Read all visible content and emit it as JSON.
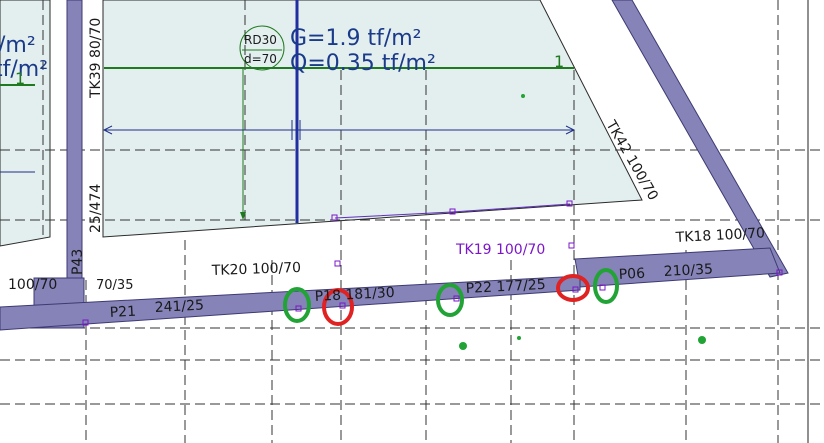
{
  "colors": {
    "beam_fill": "#8583b8",
    "beam_stroke": "#3d3a72",
    "slab_fill": "#e3eeee",
    "grid_line": "#222222",
    "dimension_line": "#1f2f8a",
    "load_line": "#1f7a1f",
    "marker_green": "#21a336",
    "marker_red": "#e02222",
    "highlight_purple": "#7b16c9"
  },
  "labels": {
    "rd30": "RD30",
    "d70": "d=70",
    "load_g": "G=1.9 tf/m²",
    "load_q": "Q=0.35 tf/m²",
    "load_number": "1",
    "left_tfm2_1": "/m²",
    "left_tfm2_2": "tf/m²",
    "left_one": "1",
    "tk39": "TK39 80/70",
    "tk42": "TK42 100/70",
    "p43": "P43",
    "p43_size": "25/474",
    "tk18": "TK18 100/70",
    "tk19": "TK19 100/70",
    "tk20": "TK20 100/70",
    "beam_100_70": "100/70",
    "beam_70_35": "70/35",
    "p21": "P21",
    "p21_size": "241/25",
    "p18": "P18 181/30",
    "p22": "P22 177/25",
    "p06": "P06",
    "p06_size": "210/35"
  },
  "icons": {
    "slab_circle": "slab-symbol-icon",
    "column_marker": "column-marker-icon",
    "dot_marker": "dot-marker-icon"
  }
}
